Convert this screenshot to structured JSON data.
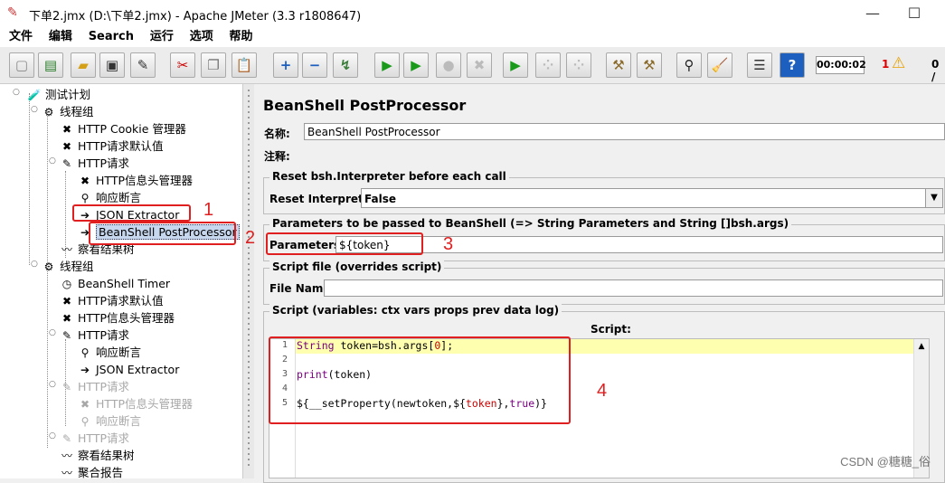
{
  "window": {
    "title": "下单2.jmx (D:\\下单2.jmx) - Apache JMeter (3.3 r1808647)",
    "minimize": "—",
    "maximize": "☐"
  },
  "menu": [
    "文件",
    "编辑",
    "Search",
    "运行",
    "选项",
    "帮助"
  ],
  "toolbar": {
    "buttons": [
      {
        "name": "new-icon",
        "glyph": "▢",
        "color": "#888"
      },
      {
        "name": "templates-icon",
        "glyph": "▤",
        "color": "#2a7d2a"
      },
      {
        "name": "open-icon",
        "glyph": "▰",
        "color": "#d4a017"
      },
      {
        "name": "save-icon",
        "glyph": "▣",
        "color": "#333"
      },
      {
        "name": "save-as-icon",
        "glyph": "✎",
        "color": "#333"
      },
      {
        "name": "cut-icon",
        "glyph": "✂",
        "color": "#c00"
      },
      {
        "name": "copy-icon",
        "glyph": "❐",
        "color": "#777"
      },
      {
        "name": "paste-icon",
        "glyph": "📋",
        "color": "#7a5a2a"
      },
      {
        "name": "expand-icon",
        "glyph": "+",
        "color": "#1d5fbf"
      },
      {
        "name": "collapse-icon",
        "glyph": "−",
        "color": "#1d5fbf"
      },
      {
        "name": "toggle-icon",
        "glyph": "↯",
        "color": "#3a7d3a"
      },
      {
        "name": "start-icon",
        "glyph": "▶",
        "color": "#1a9a1a"
      },
      {
        "name": "start-no-pause-icon",
        "glyph": "▶",
        "color": "#1a9a1a"
      },
      {
        "name": "stop-icon",
        "glyph": "●",
        "color": "#bbb"
      },
      {
        "name": "shutdown-icon",
        "glyph": "✖",
        "color": "#bbb"
      },
      {
        "name": "remote-start-icon",
        "glyph": "▶",
        "color": "#1a9a1a"
      },
      {
        "name": "remote-stop-icon",
        "glyph": "⁘",
        "color": "#bbb"
      },
      {
        "name": "remote-shutdown-icon",
        "glyph": "⁘",
        "color": "#bbb"
      },
      {
        "name": "clear-icon",
        "glyph": "⚒",
        "color": "#8a6a2a"
      },
      {
        "name": "clear-all-icon",
        "glyph": "⚒",
        "color": "#8a6a2a"
      },
      {
        "name": "search-icon",
        "glyph": "⚲",
        "color": "#222"
      },
      {
        "name": "reset-search-icon",
        "glyph": "🧹",
        "color": "#c90"
      },
      {
        "name": "function-helper-icon",
        "glyph": "☰",
        "color": "#333"
      },
      {
        "name": "help-icon",
        "glyph": "?",
        "color": "#fff"
      }
    ],
    "timer": "00:00:02",
    "error_count": "1",
    "warn_glyph": "⚠",
    "thread_ratio": "0 /"
  },
  "tree": [
    {
      "label": "测试计划",
      "icon": "🧪",
      "disabled": false
    },
    {
      "label": "线程组",
      "icon": "⚙",
      "disabled": false
    },
    {
      "label": "HTTP Cookie 管理器",
      "icon": "✖",
      "disabled": false
    },
    {
      "label": "HTTP请求默认值",
      "icon": "✖",
      "disabled": false
    },
    {
      "label": "HTTP请求",
      "icon": "✎",
      "disabled": false
    },
    {
      "label": "HTTP信息头管理器",
      "icon": "✖",
      "disabled": false
    },
    {
      "label": "响应断言",
      "icon": "⚲",
      "disabled": false
    },
    {
      "label": "JSON Extractor",
      "icon": "➔",
      "disabled": false
    },
    {
      "label": "BeanShell PostProcessor",
      "icon": "➔",
      "disabled": false
    },
    {
      "label": "察看结果树",
      "icon": "〰",
      "disabled": false
    },
    {
      "label": "线程组",
      "icon": "⚙",
      "disabled": false
    },
    {
      "label": "BeanShell Timer",
      "icon": "◷",
      "disabled": false
    },
    {
      "label": "HTTP请求默认值",
      "icon": "✖",
      "disabled": false
    },
    {
      "label": "HTTP信息头管理器",
      "icon": "✖",
      "disabled": false
    },
    {
      "label": "HTTP请求",
      "icon": "✎",
      "disabled": false
    },
    {
      "label": "响应断言",
      "icon": "⚲",
      "disabled": false
    },
    {
      "label": "JSON Extractor",
      "icon": "➔",
      "disabled": false
    },
    {
      "label": "HTTP请求",
      "icon": "✎",
      "disabled": true
    },
    {
      "label": "HTTP信息头管理器",
      "icon": "✖",
      "disabled": true
    },
    {
      "label": "响应断言",
      "icon": "⚲",
      "disabled": true
    },
    {
      "label": "HTTP请求",
      "icon": "✎",
      "disabled": true
    },
    {
      "label": "察看结果树",
      "icon": "〰",
      "disabled": false
    },
    {
      "label": "聚合报告",
      "icon": "〰",
      "disabled": false
    }
  ],
  "editor": {
    "title": "BeanShell PostProcessor",
    "name_label": "名称:",
    "name_value": "BeanShell PostProcessor",
    "comment_label": "注释:",
    "comment_value": "",
    "reset_group": "Reset bsh.Interpreter before each call",
    "reset_label": "Reset Interpreter:",
    "reset_value": "False",
    "params_group": "Parameters to be passed to BeanShell (=> String Parameters and String []bsh.args)",
    "params_label": "Parameters:",
    "params_value": "${token}",
    "file_group": "Script file (overrides script)",
    "file_label": "File Name:",
    "file_value": "",
    "script_group": "Script (variables: ctx vars props prev data log)",
    "script_heading": "Script:",
    "line_numbers": [
      "1",
      "2",
      "3",
      "4",
      "5"
    ]
  },
  "annotations": [
    "1",
    "2",
    "3",
    "4"
  ],
  "watermark": "CSDN @糖糖_俗"
}
